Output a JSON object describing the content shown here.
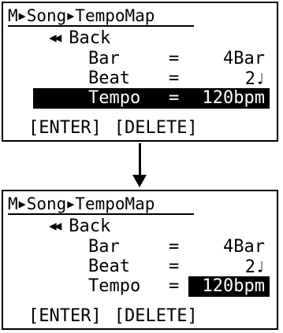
{
  "screens": [
    {
      "breadcrumb": [
        "M",
        "Song",
        "TempoMap"
      ],
      "back": {
        "arrows": "◀◀",
        "label": "Back"
      },
      "params": [
        {
          "label": "Bar",
          "eq": "=",
          "value": "4Bar",
          "note": ""
        },
        {
          "label": "Beat",
          "eq": "=",
          "value": "2",
          "note": "♩"
        },
        {
          "label": "Tempo",
          "eq": "=",
          "value": "120bpm",
          "note": ""
        }
      ],
      "selection": "full-row",
      "footer": {
        "enter": "[ENTER]",
        "delete": "[DELETE]"
      }
    },
    {
      "breadcrumb": [
        "M",
        "Song",
        "TempoMap"
      ],
      "back": {
        "arrows": "◀◀",
        "label": "Back"
      },
      "params": [
        {
          "label": "Bar",
          "eq": "=",
          "value": "4Bar",
          "note": ""
        },
        {
          "label": "Beat",
          "eq": "=",
          "value": "2",
          "note": "♩"
        },
        {
          "label": "Tempo",
          "eq": "=",
          "value": "120bpm",
          "note": ""
        }
      ],
      "selection": "value-only",
      "footer": {
        "enter": "[ENTER]",
        "delete": "[DELETE]"
      }
    }
  ],
  "breadcrumb_separator": "▶",
  "transition_icon": "down-arrow-icon",
  "colors": {
    "background": "#ffffff",
    "foreground": "#000000",
    "highlight": "#000000"
  }
}
